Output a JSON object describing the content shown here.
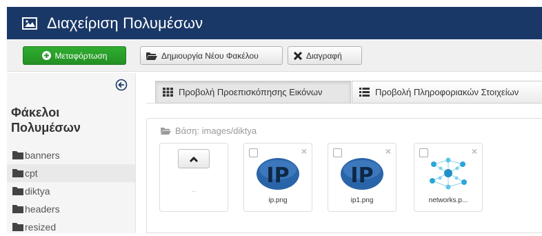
{
  "header": {
    "title": "Διαχείριση Πολυμέσων",
    "icon": "image-icon"
  },
  "toolbar": {
    "upload_label": "Μεταφόρτωση",
    "new_folder_label": "Δημιουργία Νέου Φακέλου",
    "delete_label": "Διαγραφή"
  },
  "sidebar": {
    "title": "Φάκελοι Πολυμέσων",
    "folders": [
      "banners",
      "cpt",
      "diktya",
      "headers",
      "resized"
    ],
    "active_folder": "cpt"
  },
  "tabs": [
    {
      "label": "Προβολή Προεπισκόπησης Εικόνων",
      "icon": "grid-icon"
    },
    {
      "label": "Προβολή Πληροφοριακών Στοιχείων",
      "icon": "list-icon"
    }
  ],
  "breadcrumb": {
    "text": "Βάση: images/diktya"
  },
  "up": {
    "label": ".."
  },
  "files": [
    {
      "name": "ip.png",
      "type": "ip"
    },
    {
      "name": "ip1.png",
      "type": "ip"
    },
    {
      "name": "networks.p...",
      "type": "network"
    }
  ],
  "colors": {
    "header_bg": "#1a3867",
    "upload_green": "#28a228",
    "ip_blue": "#2a64a8"
  }
}
